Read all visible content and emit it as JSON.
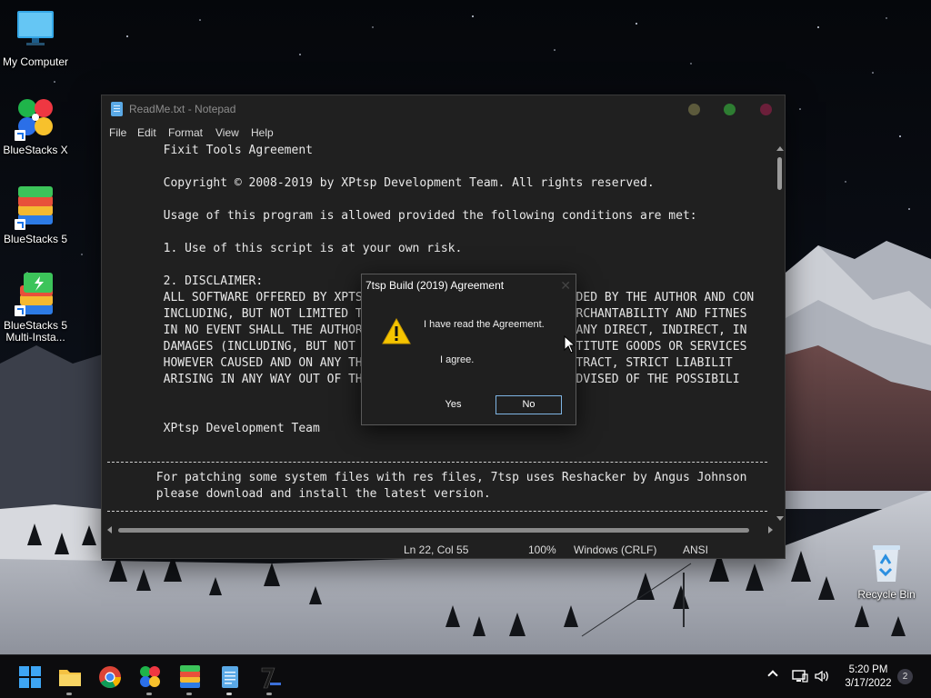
{
  "desktop": {
    "icons": [
      {
        "label": "My Computer"
      },
      {
        "label": "BlueStacks X"
      },
      {
        "label": "BlueStacks 5"
      },
      {
        "label": "BlueStacks 5 Multi-Insta..."
      },
      {
        "label": "Recycle Bin"
      }
    ]
  },
  "notepad": {
    "title": "ReadMe.txt - Notepad",
    "menu": [
      "File",
      "Edit",
      "Format",
      "View",
      "Help"
    ],
    "lines": [
      "        Fixit Tools Agreement",
      "",
      "        Copyright © 2008-2019 by XPtsp Development Team. All rights reserved.",
      "",
      "        Usage of this program is allowed provided the following conditions are met:",
      "",
      "        1. Use of this script is at your own risk.",
      "",
      "        2. DISCLAIMER:",
      "        ALL SOFTWARE OFFERED BY XPTS                            VIDED BY THE AUTHOR AND CON",
      "        INCLUDING, BUT NOT LIMITED T                            MERCHANTABILITY AND FITNES",
      "        IN NO EVENT SHALL THE AUTHOR                           OR ANY DIRECT, INDIRECT, IN",
      "        DAMAGES (INCLUDING, BUT NOT                            UBSTITUTE GOODS OR SERVICES",
      "        HOWEVER CAUSED AND ON ANY TH                           CONTRACT, STRICT LIABILIT",
      "        ARISING IN ANY WAY OUT OF TH                           F ADVISED OF THE POSSIBILI",
      "",
      "",
      "        XPtsp Development Team"
    ],
    "note_line1": "       For patching some system files with res files, 7tsp uses Reshacker by Angus Johnson",
    "note_line2": "       please download and install the latest version.",
    "status": {
      "position": "Ln 22, Col 55",
      "zoom": "100%",
      "line_ending": "Windows (CRLF)",
      "encoding": "ANSI"
    }
  },
  "dialog": {
    "title": "7tsp Build (2019) Agreement",
    "close": "✕",
    "message": "I have read the Agreement.",
    "sub_message": "I agree.",
    "yes_label": "Yes",
    "no_label": "No"
  },
  "taskbar": {
    "apps": [
      "start-icon",
      "file-explorer-icon",
      "chrome-icon",
      "bluestacks-x-icon",
      "bluestacks-5-icon",
      "notepad-icon",
      "7tsp-icon"
    ],
    "time": "5:20 PM",
    "date": "3/17/2022",
    "notification_count": "2"
  }
}
